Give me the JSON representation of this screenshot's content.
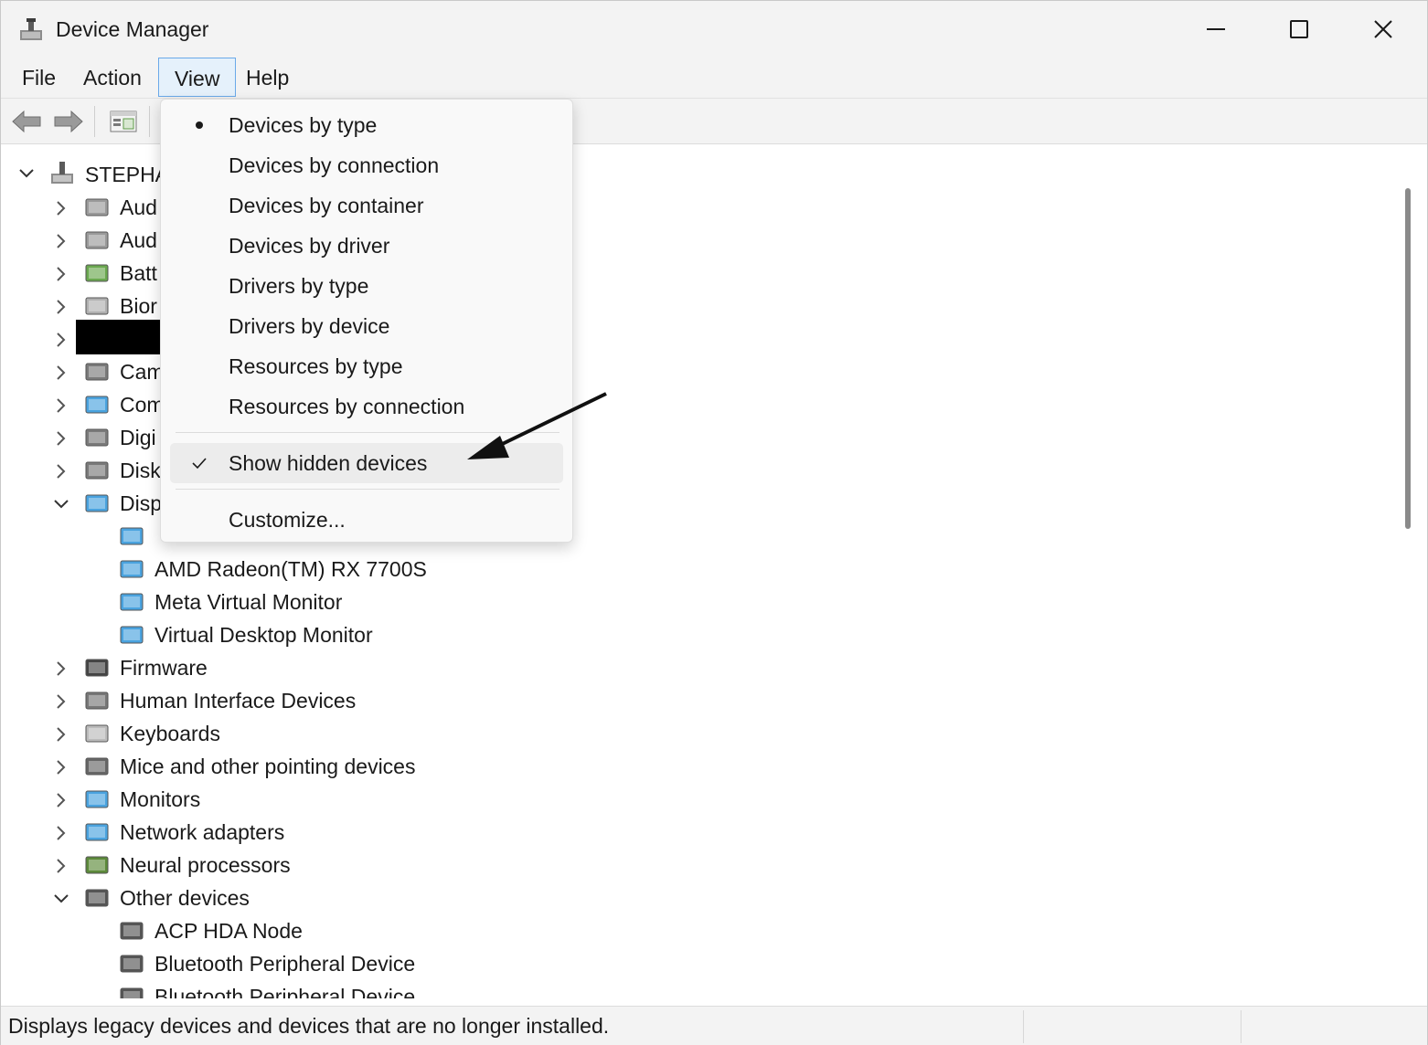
{
  "window": {
    "title": "Device Manager"
  },
  "menubar": {
    "items": [
      "File",
      "Action",
      "View",
      "Help"
    ],
    "active": "View"
  },
  "tree": {
    "root": "STEPHA",
    "rows": [
      {
        "label": "Aud",
        "expanded": false
      },
      {
        "label": "Aud",
        "expanded": false
      },
      {
        "label": "Batt",
        "expanded": false
      },
      {
        "label": "Bior",
        "expanded": false
      },
      {
        "label": "",
        "expanded": false,
        "redacted": true
      },
      {
        "label": "Cam",
        "expanded": false
      },
      {
        "label": "Com",
        "expanded": false
      },
      {
        "label": "Digi",
        "expanded": false
      },
      {
        "label": "Disk",
        "expanded": false
      },
      {
        "label": "Disp",
        "expanded": true
      }
    ],
    "display_children": [
      "AMD Radeon(TM) RX 7700S",
      "Meta Virtual Monitor",
      "Virtual Desktop Monitor"
    ],
    "rows_after": [
      {
        "label": "Firmware",
        "expanded": false
      },
      {
        "label": "Human Interface Devices",
        "expanded": false
      },
      {
        "label": "Keyboards",
        "expanded": false
      },
      {
        "label": "Mice and other pointing devices",
        "expanded": false
      },
      {
        "label": "Monitors",
        "expanded": false
      },
      {
        "label": "Network adapters",
        "expanded": false
      },
      {
        "label": "Neural processors",
        "expanded": false
      },
      {
        "label": "Other devices",
        "expanded": true
      }
    ],
    "other_children": [
      "ACP HDA Node",
      "Bluetooth Peripheral Device",
      "Bluetooth Peripheral Device"
    ]
  },
  "view_menu": {
    "items": [
      {
        "label": "Devices by type",
        "mark": "bullet"
      },
      {
        "label": "Devices by connection",
        "mark": ""
      },
      {
        "label": "Devices by container",
        "mark": ""
      },
      {
        "label": "Devices by driver",
        "mark": ""
      },
      {
        "label": "Drivers by type",
        "mark": ""
      },
      {
        "label": "Drivers by device",
        "mark": ""
      },
      {
        "label": "Resources by type",
        "mark": ""
      },
      {
        "label": "Resources by connection",
        "mark": ""
      }
    ],
    "show_hidden": {
      "label": "Show hidden devices",
      "checked": true
    },
    "customize": "Customize..."
  },
  "statusbar": {
    "text": "Displays legacy devices and devices that are no longer installed."
  },
  "colors": {
    "menu_active_bg": "#e5f1fb",
    "menu_active_border": "#6aa9e9",
    "hover": "#ececec"
  }
}
